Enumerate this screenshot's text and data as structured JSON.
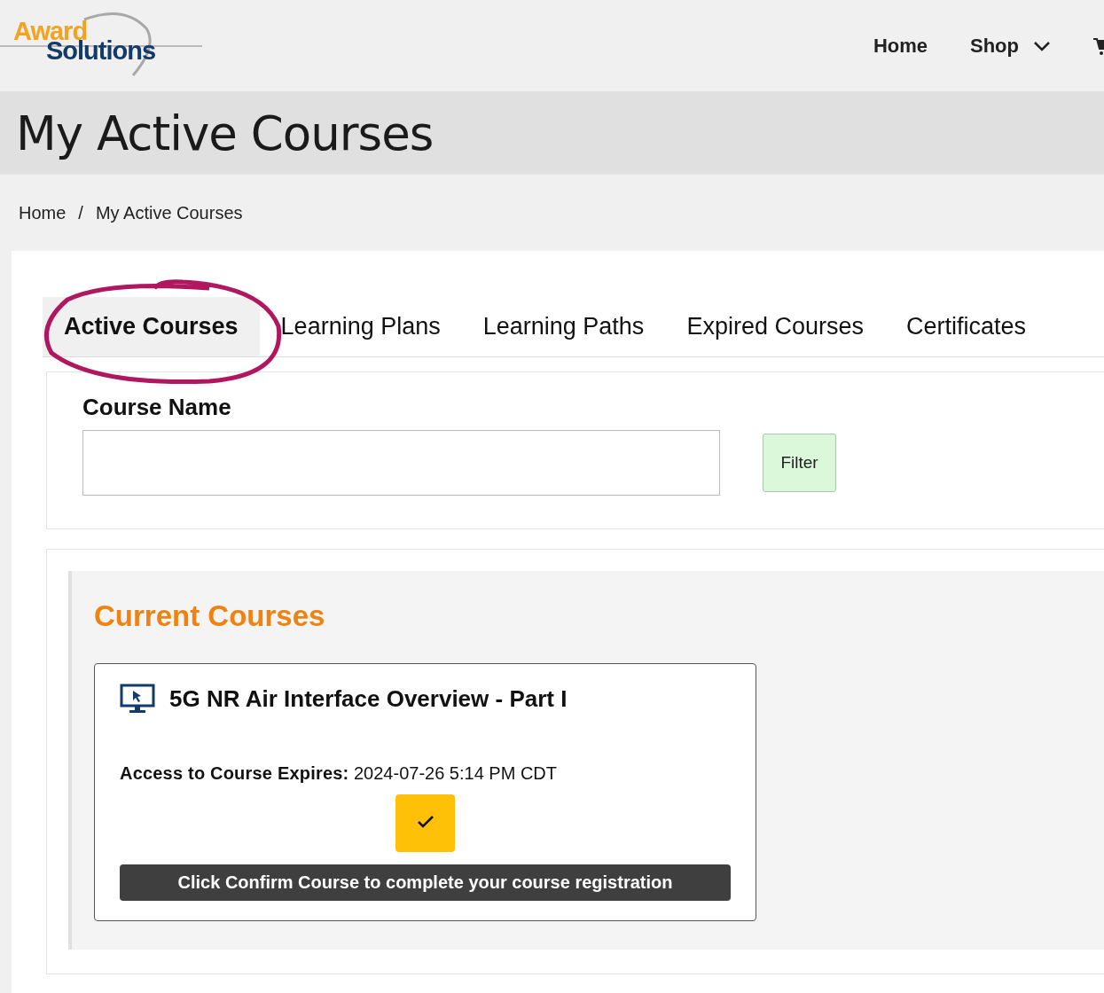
{
  "logo": {
    "line_1": "Award",
    "line_2": "Solutions"
  },
  "nav": {
    "items": [
      {
        "label": "Home",
        "kind": "link"
      },
      {
        "label": "Shop",
        "kind": "dropdown"
      }
    ]
  },
  "page_title": "My Active Courses",
  "breadcrumb": [
    "Home",
    "My Active Courses"
  ],
  "breadcrumb_separator": "/",
  "tabs": [
    {
      "label": "Active Courses",
      "selected": true
    },
    {
      "label": "Learning Plans",
      "selected": false
    },
    {
      "label": "Learning Paths",
      "selected": false
    },
    {
      "label": "Expired Courses",
      "selected": false
    },
    {
      "label": "Certificates",
      "selected": false
    }
  ],
  "filter": {
    "label": "Course Name",
    "button": "Filter"
  },
  "section_title": "Current Courses",
  "courses": [
    {
      "title": "5G NR Air Interface Overview - Part I",
      "expires_label": "Access to Course Expires:",
      "expires_value": "2024-07-26 5:14 PM CDT",
      "confirm_notice": "Click Confirm Course to complete your course registration"
    }
  ]
}
